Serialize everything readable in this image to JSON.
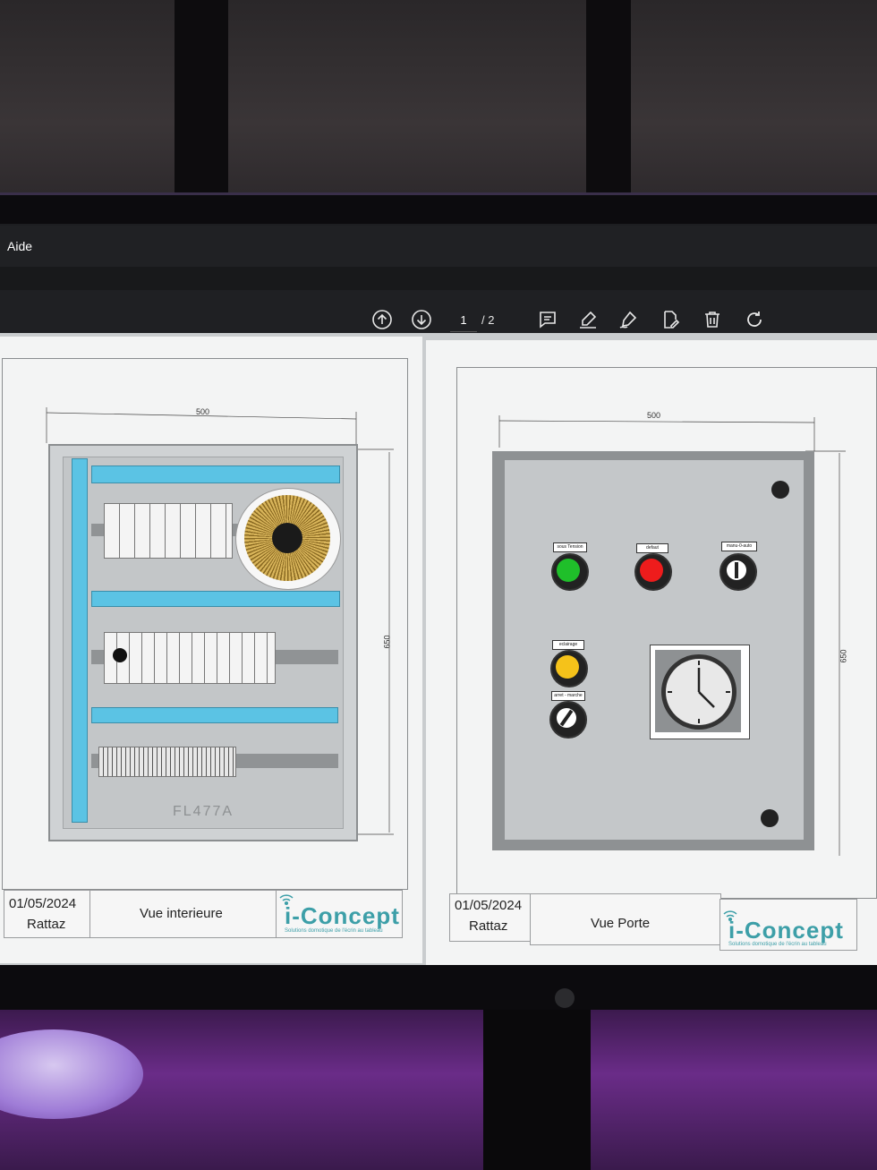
{
  "menu": {
    "help": "Aide"
  },
  "toolbar": {
    "page_current": "1",
    "page_total": "/ 2",
    "icons": [
      "arrow-up-circle-icon",
      "arrow-down-circle-icon",
      "comment-icon",
      "highlighter-icon",
      "draw-pen-icon",
      "edit-document-icon",
      "trash-icon",
      "rotate-icon"
    ]
  },
  "page_left": {
    "dim_width": "500",
    "dim_height": "650",
    "enclosure_ref": "FL477A",
    "date": "01/05/2024",
    "author": "Rattaz",
    "view_title": "Vue interieure",
    "logo": "i-Concept",
    "logo_tagline": "Solutions domotique de l'écrin au tableau"
  },
  "page_right": {
    "dim_width": "500",
    "dim_height": "650",
    "date": "01/05/2024",
    "author": "Rattaz",
    "view_title": "Vue Porte",
    "logo": "i-Concept",
    "logo_tagline": "Solutions domotique de l'écrin au tableau",
    "controls": {
      "green_label": "sous Tension",
      "red_label": "defaut",
      "selector1_label": "manu-0-auto",
      "yellow_label": "eclairage",
      "selector2_label": "arret - marche"
    }
  },
  "colors": {
    "lamp_green": "#1fbf2a",
    "lamp_red": "#ee1c1c",
    "lamp_yellow": "#f5c21a",
    "rail_blue": "#5bc3e4",
    "logo_teal": "#3d9fa8"
  }
}
